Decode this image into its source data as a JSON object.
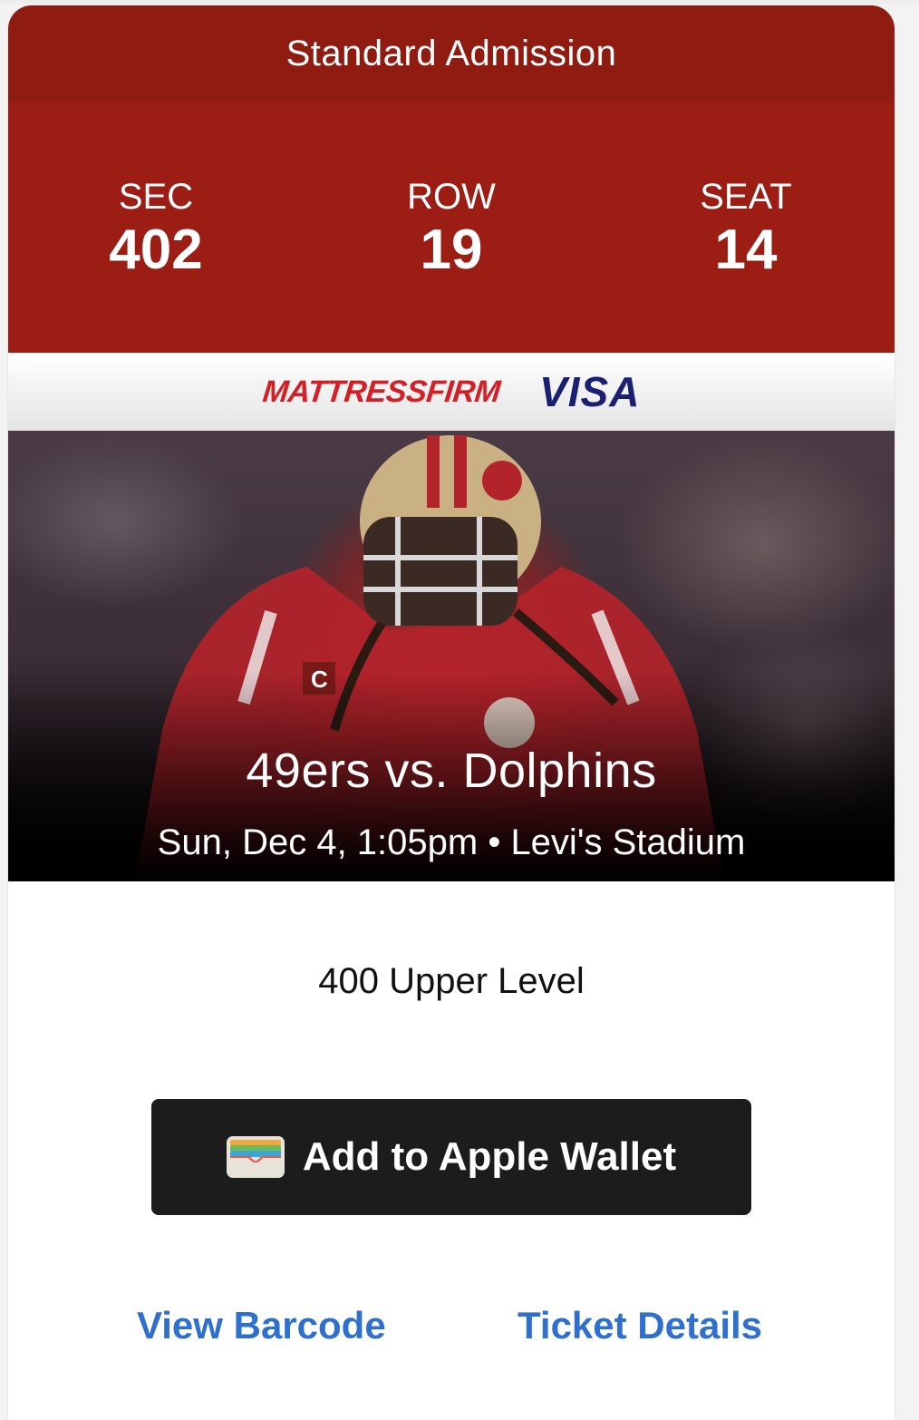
{
  "ticket": {
    "admission_type": "Standard Admission",
    "section_label": "SEC",
    "section_value": "402",
    "row_label": "ROW",
    "row_value": "19",
    "seat_label": "SEAT",
    "seat_value": "14"
  },
  "sponsors": {
    "mattress_firm": "MATTRESSFIRM",
    "visa": "VISA"
  },
  "event": {
    "title": "49ers vs. Dolphins",
    "subtitle": "Sun, Dec 4, 1:05pm • Levi's Stadium"
  },
  "seating_area": "400 Upper Level",
  "actions": {
    "wallet_label": "Add to Apple Wallet",
    "wallet_icon": "wallet-icon",
    "view_barcode": "View Barcode",
    "ticket_details": "Ticket Details"
  },
  "colors": {
    "header_red": "#8f1b11",
    "band_red": "#9b1d13",
    "link_blue": "#2f6fce",
    "button_dark": "#1c1c1c"
  }
}
